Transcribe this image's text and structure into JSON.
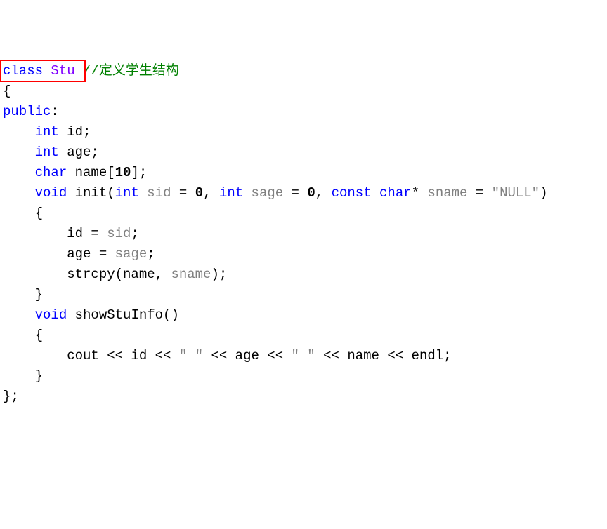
{
  "tokens": {
    "class": "class",
    "Stu": "Stu",
    "comment1": "//定义学生结构",
    "lbrace": "{",
    "public": "public",
    "colon": ":",
    "int1": "int",
    "id_decl": "id;",
    "int2": "int",
    "age_decl": "age;",
    "char1": "char",
    "name_decl1": "name[",
    "ten": "10",
    "name_decl2": "];",
    "void1": "void",
    "init": "init",
    "int3": "int",
    "sid": "sid",
    "zero1": "0",
    "int4": "int",
    "sage": "sage",
    "zero2": "0",
    "const": "const",
    "char2": "char",
    "sname": "sname",
    "null_str": "″NULL″",
    "lbrace2": "{",
    "id_assign1": "id = ",
    "sid2": "sid",
    "semi1": ";",
    "age_assign1": "age = ",
    "sage2": "sage",
    "semi2": ";",
    "strcpy1": "strcpy(name, ",
    "sname2": "sname",
    "strcpy2": ");",
    "rbrace1": "}",
    "void2": "void",
    "showStuInfo": "showStuInfo",
    "parens": "()",
    "lbrace3": "{",
    "cout1": "cout << id << ",
    "space1": "″ ″",
    "cout2": " << age << ",
    "space2": "″ ″",
    "cout3": " << name << endl;",
    "rbrace2": "}",
    "rbrace3": "};"
  }
}
